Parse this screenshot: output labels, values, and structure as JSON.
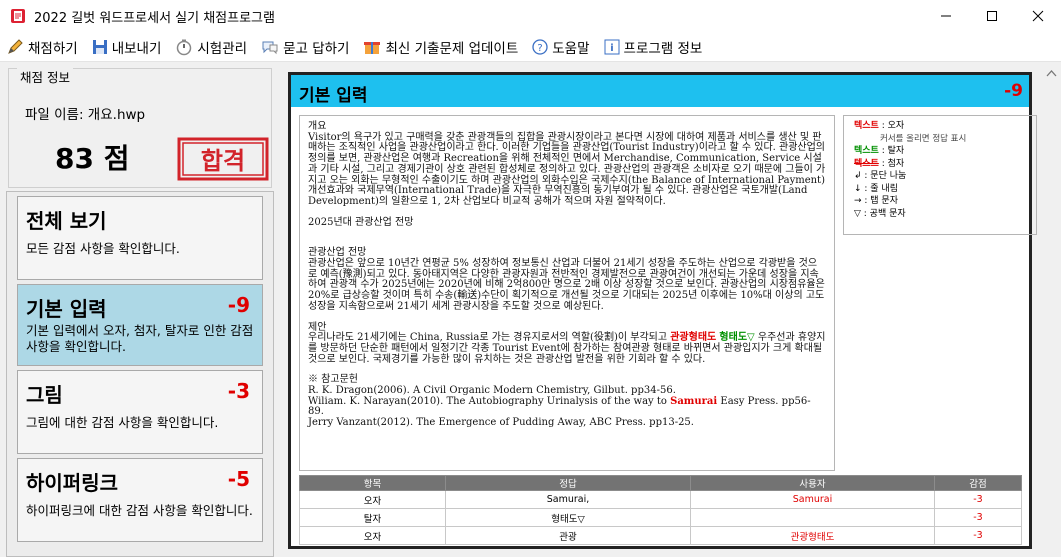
{
  "window": {
    "title": "2022 길벗 워드프로세서 실기 채점프로그램"
  },
  "menu": [
    {
      "label": "채점하기",
      "icon": "pencil-icon"
    },
    {
      "label": "내보내기",
      "icon": "save-icon"
    },
    {
      "label": "시험관리",
      "icon": "timer-icon"
    },
    {
      "label": "묻고 답하기",
      "icon": "chat-icon"
    },
    {
      "label": "최신 기출문제 업데이트",
      "icon": "gift-icon"
    },
    {
      "label": "도움말",
      "icon": "help-icon"
    },
    {
      "label": "프로그램 정보",
      "icon": "info-icon"
    }
  ],
  "score_panel": {
    "legend": "채점 정보",
    "filename": "파일 이름: 개요.hwp",
    "score": "83 점",
    "stamp": "합격"
  },
  "categories": [
    {
      "title": "전체 보기",
      "penalty": "",
      "desc": "모든 감점 사항을 확인합니다.",
      "active": false
    },
    {
      "title": "기본 입력",
      "penalty": "-9",
      "desc": "기본 입력에서 오자, 첨자, 탈자로 인한 감점 사항을 확인합니다.",
      "active": true
    },
    {
      "title": "그림",
      "penalty": "-3",
      "desc": "그림에 대한 감점 사항을 확인합니다.",
      "active": false
    },
    {
      "title": "하이퍼링크",
      "penalty": "-5",
      "desc": "하이퍼링크에 대한 감점 사항을 확인합니다.",
      "active": false
    }
  ],
  "section": {
    "title": "기본 입력",
    "penalty": "-9"
  },
  "document": {
    "heading": "개요",
    "p1": "Visitor의 욕구가 있고 구매력을 갖춘 관광객들의 집합을 관광시장이라고 본다면 시장에 대하여 제품과 서비스를 생산 및 판매하는 조직적인 사업을 관광산업이라고 한다. 이러한 기업들을 관광산업(Tourist Industry)이라고 할 수 있다. 관광산업의 정의를 보면, 관광산업은 여행과 Recreation을 위해 전체적인 면에서 Merchandise, Communication, Service 시설과 기타 시설, 그리고 경제기관이 상호 관련된 합성체로 정의하고 있다. 관광산업의 관광객은 소비자로 오기 때문에 그들이 가지고 오는 외화는 무형적인 수출이기도 하며 관광산업의 외화수입은 국제수지(the Balance of International Payment) 개선효과와 국제무역(International Trade)을 자극한 무역진흥의 동기부여가 될 수 있다. 관광산업은 국토개발(Land Development)의 일환으로 1, 2차 산업보다 비교적 공해가 적으며 자원 절약적이다.",
    "s2_title": "2025년대 관광산업 전망",
    "s3_title": "관광산업 전망",
    "p3": "관광산업은 앞으로 10년간 연평균 5% 성장하여 정보통신 산업과 더불어 21세기 성장을 주도하는 산업으로 각광받을 것으로 예측(豫測)되고 있다. 동아태지역은 다양한 관광자원과 전반적인 경제발전으로 관광여건이 개선되는 가운데 성장을 지속하여 관광객 수가 2025년에는 2020년에 비해 2억800만 명으로 2배 이상 성장할 것으로 보인다. 관광산업의 시장점유율은 20%로 급상승할 것이며 특히 수송(輸送)수단이 획기적으로 개선될 것으로 기대되는 2025년 이후에는 10%대 이상의 고도성장을 지속함으로써 21세기 세계 관광시장을 주도할 것으로 예상된다.",
    "s4_title": "제안",
    "p4_a": "우리나라도 21세기에는 China, Russia로 가는 경유지로서의 역할(役割)이 부각되고 ",
    "p4_err1": "관광형태도",
    "p4_err2": "형태도▽",
    "p4_b": " 우주선과 휴양지를 방문하던 단순한 패턴에서 일정기간 각종 Tourist Event에 참가하는 참여관광 형태로 바뀌면서 관광입지가 크게 확대될 것으로 보인다. 국제경기를 가능한 많이 유치하는 것은 관광산업 발전을 위한 기회라 할 수 있다.",
    "ref_title": "※ 참고문헌",
    "ref1": "R. K. Dragon(2006). A Civil Organic Modern Chemistry, Gilbut. pp34-56.",
    "ref2_a": "Wiliam. K. Narayan(2010). The Autobiography Urinalysis of the way to ",
    "ref2_err": "Samurai",
    "ref2_b": " Easy Press. pp56-89.",
    "ref3": "Jerry Vanzant(2012). The Emergence of Pudding Away, ABC Press. pp13-25."
  },
  "legend": {
    "r1_mark": "텍스트",
    "r1_label": " : 오자",
    "r1_sub": "커서를 올리면 정답 표시",
    "r2_mark": "텍스트",
    "r2_label": " : 탈자",
    "r3_mark": "텍스트",
    "r3_label": " : 첨자",
    "r4": "↲ : 문단 나눔",
    "r5": "↓ : 줄 내림",
    "r6": "→ : 탭 문자",
    "r7": "▽ : 공백 문자"
  },
  "result_table": {
    "headers": [
      "항목",
      "정답",
      "사용자",
      "감점"
    ],
    "rows": [
      [
        "오자",
        "Samurai,",
        "Samurai",
        "-3"
      ],
      [
        "탈자",
        "형태도▽",
        "",
        "-3"
      ],
      [
        "오자",
        "관광",
        "관광형태도",
        "-3"
      ]
    ]
  }
}
